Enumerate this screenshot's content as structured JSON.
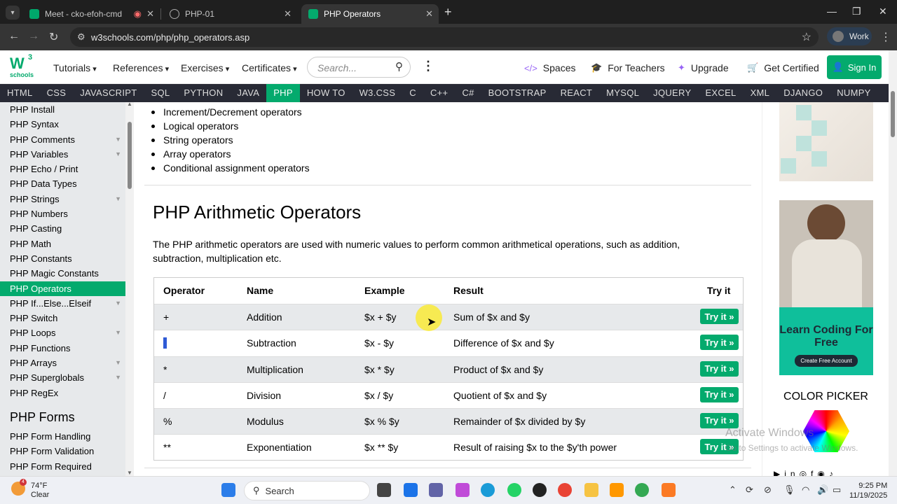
{
  "browser": {
    "tabs": [
      {
        "label": "Meet - cko-efoh-cmd"
      },
      {
        "label": "PHP-01"
      },
      {
        "label": "PHP Operators"
      }
    ],
    "url": "w3schools.com/php/php_operators.asp",
    "profile": "Work"
  },
  "header": {
    "logo_sup": "3",
    "logo_text": "schools",
    "menus": [
      "Tutorials",
      "References",
      "Exercises",
      "Certificates"
    ],
    "search_placeholder": "Search...",
    "links": [
      "Spaces",
      "For Teachers",
      "Upgrade",
      "Get Certified"
    ],
    "signin": "Sign In"
  },
  "topnav": [
    "HTML",
    "CSS",
    "JAVASCRIPT",
    "SQL",
    "PYTHON",
    "JAVA",
    "PHP",
    "HOW TO",
    "W3.CSS",
    "C",
    "C++",
    "C#",
    "BOOTSTRAP",
    "REACT",
    "MYSQL",
    "JQUERY",
    "EXCEL",
    "XML",
    "DJANGO",
    "NUMPY"
  ],
  "sidebar": {
    "items": [
      "PHP Install",
      "PHP Syntax",
      "PHP Comments",
      "PHP Variables",
      "PHP Echo / Print",
      "PHP Data Types",
      "PHP Strings",
      "PHP Numbers",
      "PHP Casting",
      "PHP Math",
      "PHP Constants",
      "PHP Magic Constants",
      "PHP Operators",
      "PHP If...Else...Elseif",
      "PHP Switch",
      "PHP Loops",
      "PHP Functions",
      "PHP Arrays",
      "PHP Superglobals",
      "PHP RegEx"
    ],
    "section": "PHP Forms",
    "form_items": [
      "PHP Form Handling",
      "PHP Form Validation",
      "PHP Form Required"
    ]
  },
  "main": {
    "bullets": [
      "Increment/Decrement operators",
      "Logical operators",
      "String operators",
      "Array operators",
      "Conditional assignment operators"
    ],
    "heading": "PHP Arithmetic Operators",
    "intro": "The PHP arithmetic operators are used with numeric values to perform common arithmetical operations, such as addition, subtraction, multiplication etc.",
    "table": {
      "headers": [
        "Operator",
        "Name",
        "Example",
        "Result",
        "Try it"
      ],
      "rows": [
        {
          "op": "+",
          "name": "Addition",
          "ex": "$x + $y",
          "res": "Sum of $x and $y"
        },
        {
          "op": "-",
          "name": "Subtraction",
          "ex": "$x - $y",
          "res": "Difference of $x and $y"
        },
        {
          "op": "*",
          "name": "Multiplication",
          "ex": "$x * $y",
          "res": "Product of $x and $y"
        },
        {
          "op": "/",
          "name": "Division",
          "ex": "$x / $y",
          "res": "Quotient of $x and $y"
        },
        {
          "op": "%",
          "name": "Modulus",
          "ex": "$x % $y",
          "res": "Remainder of $x divided by $y"
        },
        {
          "op": "**",
          "name": "Exponentiation",
          "ex": "$x ** $y",
          "res": "Result of raising $x to the $y'th power"
        }
      ],
      "try_label": "Try it »"
    }
  },
  "ads": {
    "learn": "Learn Coding For Free",
    "cta": "Create Free Account",
    "color_picker": "COLOR PICKER"
  },
  "watermark": {
    "line1": "Activate Windows",
    "line2": "Go to Settings to activate Windows."
  },
  "taskbar": {
    "temp": "74°F",
    "cond": "Clear",
    "badge": "4",
    "search": "Search",
    "time": "9:25 PM",
    "date": "11/19/2025"
  }
}
